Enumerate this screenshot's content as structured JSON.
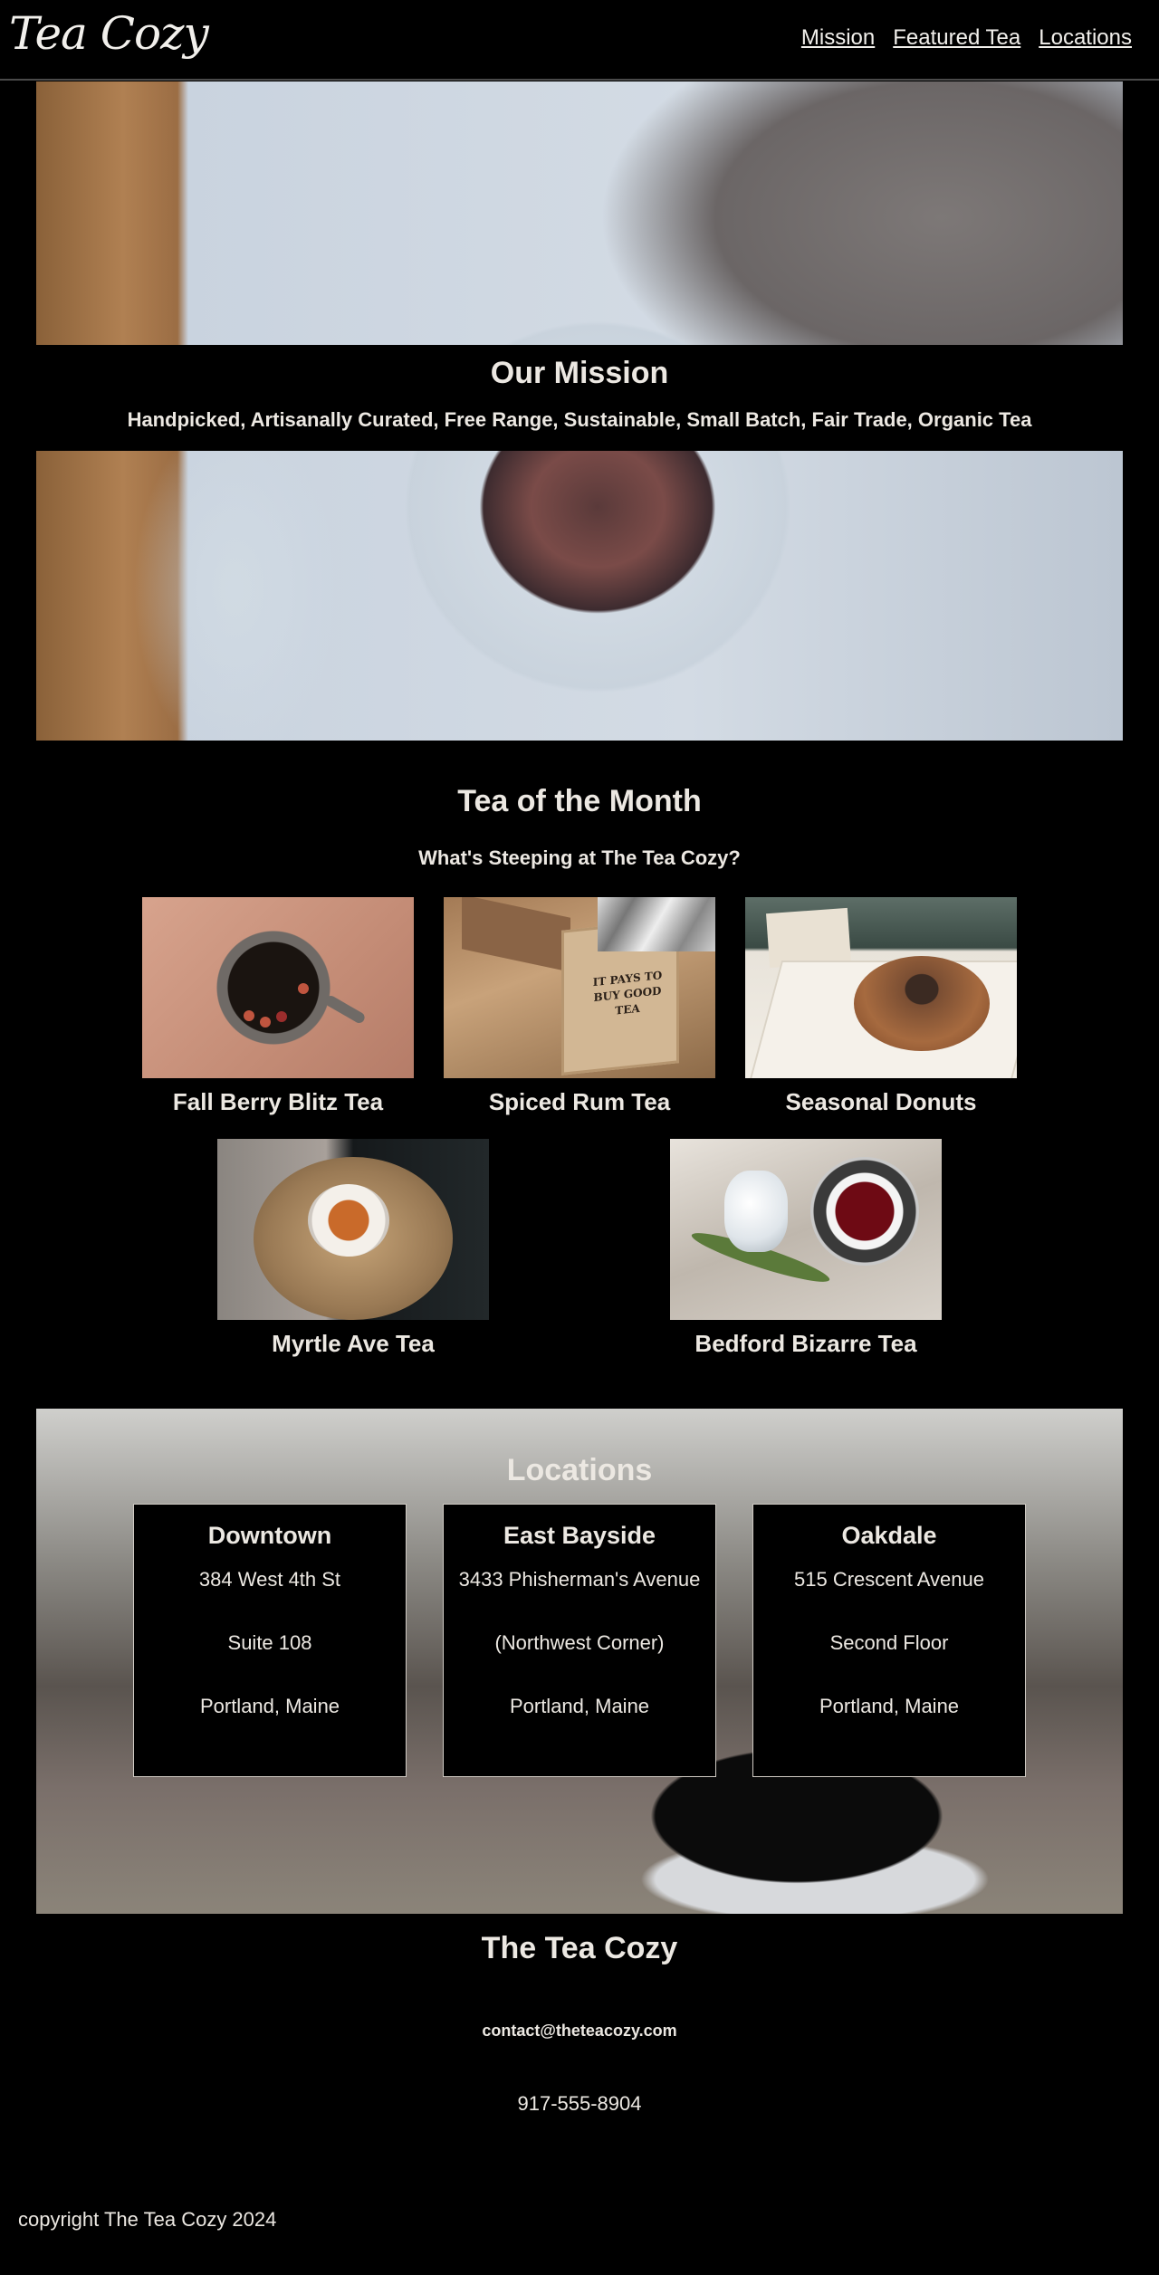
{
  "header": {
    "logo": "Tea Cozy",
    "nav": [
      "Mission",
      "Featured Tea",
      "Locations"
    ]
  },
  "mission": {
    "title": "Our Mission",
    "subtitle": "Handpicked, Artisanally Curated, Free Range, Sustainable, Small Batch, Fair Trade, Organic Tea"
  },
  "tea_of_month": {
    "title": "Tea of the Month",
    "subtitle": "What's Steeping at The Tea Cozy?",
    "items": [
      {
        "name": "Fall Berry Blitz Tea"
      },
      {
        "name": "Spiced Rum Tea",
        "box_text": "IT PAYS TO BUY GOOD TEA"
      },
      {
        "name": "Seasonal Donuts"
      },
      {
        "name": "Myrtle Ave Tea"
      },
      {
        "name": "Bedford Bizarre Tea"
      }
    ]
  },
  "locations": {
    "title": "Locations",
    "stores": [
      {
        "name": "Downtown",
        "lines": [
          "384 West 4th St",
          "Suite 108",
          "Portland, Maine"
        ]
      },
      {
        "name": "East Bayside",
        "lines": [
          "3433 Phisherman's Avenue",
          "(Northwest Corner)",
          "Portland, Maine"
        ]
      },
      {
        "name": "Oakdale",
        "lines": [
          "515 Crescent Avenue",
          "Second Floor",
          "Portland, Maine"
        ]
      }
    ]
  },
  "footer": {
    "title": "The Tea Cozy",
    "email": "contact@theteacozy.com",
    "phone": "917-555-8904",
    "copyright": "copyright The Tea Cozy 2024"
  }
}
